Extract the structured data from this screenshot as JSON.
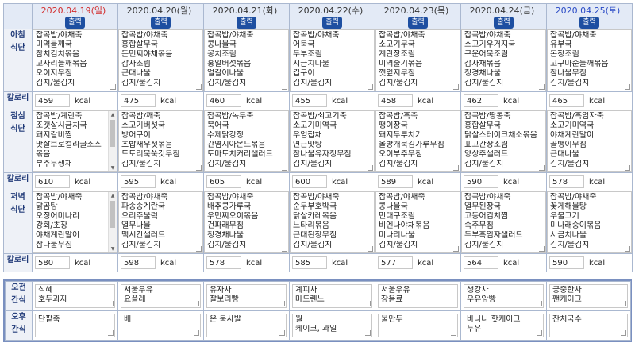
{
  "print_label": "출력",
  "days": [
    {
      "date": "2020.04.19(일)",
      "type": "sun"
    },
    {
      "date": "2020.04.20(월)",
      "type": "wk"
    },
    {
      "date": "2020.04.21(화)",
      "type": "wk"
    },
    {
      "date": "2020.04.22(수)",
      "type": "wk"
    },
    {
      "date": "2020.04.23(목)",
      "type": "wk"
    },
    {
      "date": "2020.04.24(금)",
      "type": "wk"
    },
    {
      "date": "2020.04.25(토)",
      "type": "sat"
    }
  ],
  "labels": {
    "breakfast": [
      "아침",
      "식단"
    ],
    "lunch": [
      "점심",
      "식단"
    ],
    "dinner": [
      "저녁",
      "식단"
    ],
    "calorie": "칼로리",
    "am_snack": [
      "오전",
      "간식"
    ],
    "pm_snack": [
      "오후",
      "간식"
    ],
    "kcal": "kcal"
  },
  "breakfast": [
    [
      "잡곡밥/야채죽",
      "미역들깨국",
      "참치김치볶음",
      "고사리들깨볶음",
      "오이지무침",
      "김치/물김치"
    ],
    [
      "잡곡밥/야채죽",
      "홍합살무국",
      "돈민찌야채볶음",
      "감자조림",
      "근대나물",
      "김치/물김치"
    ],
    [
      "잡곡밥/야채죽",
      "콩나물국",
      "꽁치조림",
      "홍알버섯볶음",
      "얼갈이나물",
      "김치/물김치"
    ],
    [
      "잡곡밥/야채죽",
      "어묵국",
      "두부조림",
      "시금치나물",
      "깁구이",
      "김치/물김치"
    ],
    [
      "잡곡밥/야채죽",
      "소고기무국",
      "계란장조림",
      "미역줄기볶음",
      "깻잎지무침",
      "김치/물김치"
    ],
    [
      "잡곡밥/야채죽",
      "소고기우거지국",
      "구운어묵조림",
      "감자채볶음",
      "청경채나물",
      "김치/물김치"
    ],
    [
      "잡곡밥/야채죽",
      "유부국",
      "돈장조림",
      "고구마순들깨볶음",
      "참나물무침",
      "김치/물김치"
    ]
  ],
  "lunch": [
    [
      "잡곡밥/계란죽",
      "조갯살시금치국",
      "돼지갈비찜",
      "맛살브로컬리굴소스",
      "볶음",
      "부추무생채"
    ],
    [
      "잡곡밥/깨죽",
      "소고기버섯국",
      "방어구이",
      "초밥새우젓볶음",
      "도토리묵쑥갓무침",
      "김치/물김치"
    ],
    [
      "잡곡밥/녹두죽",
      "북어국",
      "수제닭강정",
      "간염지아몬드볶음",
      "토마토치커리샐러드",
      "김치/물김치"
    ],
    [
      "잡곡밥/쇠고기죽",
      "소고기미역국",
      "우엉잡채",
      "연근맛탕",
      "참나물유자청무침",
      "김치/물김치"
    ],
    [
      "잡곡밥/흑죽",
      "팽이장국",
      "돼지두루치기",
      "올방개묵김가루무침",
      "오이부추무침",
      "김치/물김치"
    ],
    [
      "잡곡밥/땅콩죽",
      "홍합살무국",
      "닭살스테이크채소볶음",
      "표고간장조림",
      "양상추샐러드",
      "김치/물김치"
    ],
    [
      "잡곡밥/흑임자죽",
      "소고기미역국",
      "야채계란말이",
      "골뱅이무침",
      "근대나물",
      "김치/물김치"
    ]
  ],
  "dinner": [
    [
      "잡곡밥/야채죽",
      "닭곰탕",
      "오징어미나리",
      "강회/초장",
      "야채계란말이",
      "참나물무침"
    ],
    [
      "잡곡밥/야채죽",
      "파송송계란국",
      "오리주물럭",
      "열무나물",
      "맥시칸샐러드",
      "김치/물김치"
    ],
    [
      "잡곡밥/야채죽",
      "배추콩가루국",
      "우민찌오이볶음",
      "건파래무침",
      "청경채나물",
      "김치/물김치"
    ],
    [
      "잡곡밥/야채죽",
      "순두부호박국",
      "닭살카레볶음",
      "느타리볶음",
      "근대된장무침",
      "김치/물김치"
    ],
    [
      "잡곡밥/야채죽",
      "콩나물국",
      "민대구조림",
      "비엔나야채볶음",
      "미나리나물",
      "김치/물김치"
    ],
    [
      "잡곡밥/야채죽",
      "열무된장국",
      "고등어김치찜",
      "숙주무침",
      "두부흑임자샐러드",
      "김치/물김치"
    ],
    [
      "잡곡밥/야채죽",
      "꽃게해물탕",
      "우불고기",
      "미나래숭이볶음",
      "시금치나물",
      "김치/물김치"
    ]
  ],
  "cal_breakfast": [
    "459",
    "475",
    "460",
    "455",
    "458",
    "462",
    "465"
  ],
  "cal_lunch": [
    "610",
    "595",
    "605",
    "600",
    "589",
    "590",
    "578"
  ],
  "cal_dinner": [
    "580",
    "598",
    "578",
    "585",
    "577",
    "564",
    "590"
  ],
  "am_snack": [
    [
      "식혜",
      "호두과자"
    ],
    [
      "서울우유",
      "요플레"
    ],
    [
      "유자차",
      "찰보리빵"
    ],
    [
      "계피차",
      "마드렌느"
    ],
    [
      "서울우유",
      "장음료"
    ],
    [
      "생강차",
      "우유앙빵"
    ],
    [
      "궁중한차",
      "팬케이크"
    ]
  ],
  "pm_snack": [
    [
      "단팥죽"
    ],
    [
      "배"
    ],
    [
      "온 묵사발"
    ],
    [
      "월",
      "케이크, 과일"
    ],
    [
      "물만두"
    ],
    [
      "바나나 핫케이크",
      "두유"
    ],
    [
      "잔치국수"
    ]
  ]
}
